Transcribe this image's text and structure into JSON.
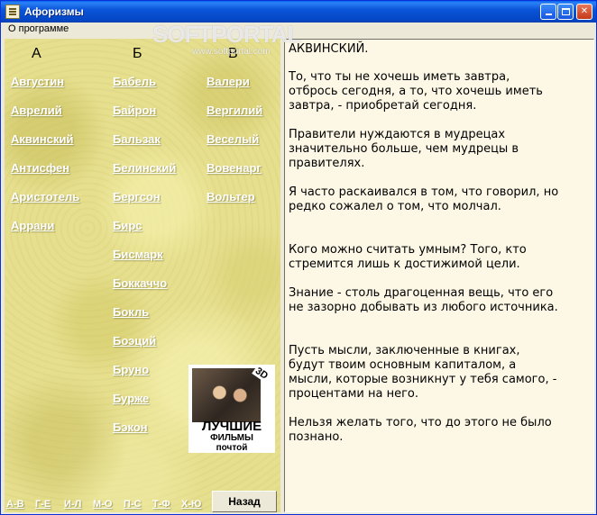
{
  "window": {
    "title": "Афоризмы"
  },
  "menu": {
    "about": "О программе"
  },
  "watermark": {
    "brand": "SOFTPORTAL",
    "url": "www.softportal.com"
  },
  "columns": {
    "letters": [
      "А",
      "Б",
      "В"
    ],
    "a": [
      "Августин",
      "Аврелий",
      "Аквинский",
      "Антисфен",
      "Аристотель",
      "Аррани"
    ],
    "b": [
      "Бабель",
      "Байрон",
      "Бальзак",
      "Белинский",
      "Бергсон",
      "Бирс",
      "Бисмарк",
      "Боккаччо",
      "Бокль",
      "Боэций",
      "Бруно",
      "Бурже",
      "Бэкон"
    ],
    "v": [
      "Валери",
      "Вергилий",
      "Веселый",
      "Вовенарг",
      "Вольтер"
    ]
  },
  "ad": {
    "badge": "3D",
    "line1": "ЛУЧШИЕ",
    "line2": "ФИЛЬМЫ",
    "line3": "почтой"
  },
  "alpha_nav": [
    "А-В",
    "Г-Е",
    "И-Л",
    "М-О",
    "П-С",
    "Т-Ф",
    "Х-Ю"
  ],
  "back_label": "Назад",
  "content": {
    "author": "АКВИНСКИЙ.",
    "quotes": [
      "То, что ты не хочешь иметь завтра, отбрось сегодня, а то, что хочешь иметь завтра, - приобретай сегодня.",
      "Правители нуждаются в мудрецах значительно больше, чем мудрецы в правителях.",
      "Я часто раскаивался в том, что говорил, но редко сожалел о том, что молчал.",
      "Кого можно считать умным? Того, кто стремится лишь к достижимой цели.",
      "Знание - столь драгоценная вещь, что его не зазорно добывать из любого источника.",
      "Пусть мысли, заключенные в книгах, будут твоим основным капиталом, а мысли, которые возникнут у тебя самого, - процентами на него.",
      "Нельзя желать того, что до этого не было познано."
    ]
  }
}
